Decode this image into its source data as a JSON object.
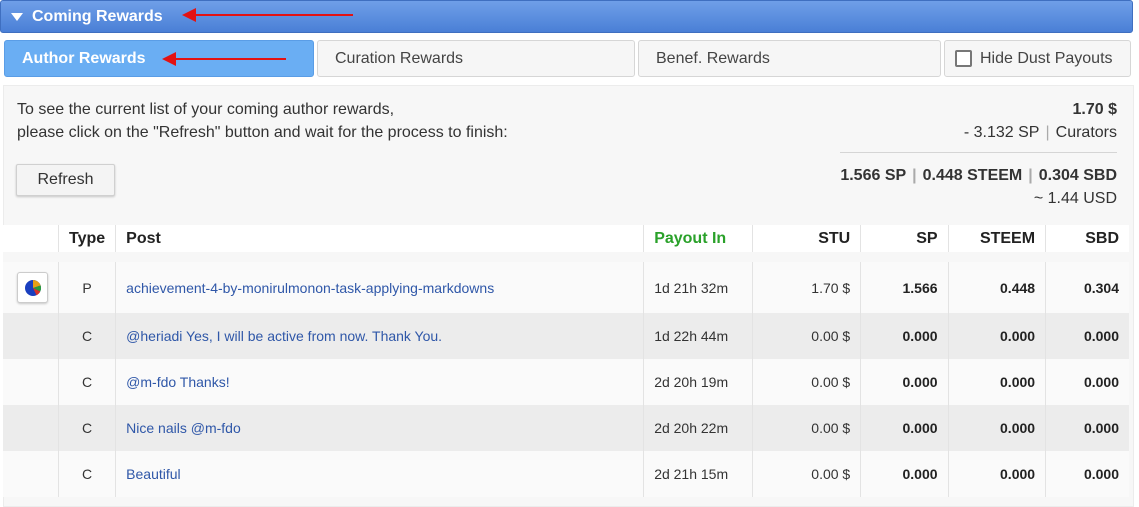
{
  "header": {
    "title": "Coming Rewards"
  },
  "tabs": [
    {
      "label": "Author Rewards",
      "active": true
    },
    {
      "label": "Curation Rewards",
      "active": false
    },
    {
      "label": "Benef. Rewards",
      "active": false
    }
  ],
  "hide_dust": {
    "label": "Hide Dust Payouts",
    "checked": false
  },
  "info": {
    "line1": "To see the current list of your coming author rewards,",
    "line2": "please click on the \"Refresh\" button and wait for the process to finish:"
  },
  "refresh_label": "Refresh",
  "summary": {
    "total_usd": "1.70 $",
    "curators_sp": "- 3.132 SP",
    "curators_label": "Curators",
    "sp": "1.566 SP",
    "steem": "0.448 STEEM",
    "sbd": "0.304 SBD",
    "approx_usd": "~ 1.44 USD"
  },
  "table": {
    "headers": [
      "",
      "Type",
      "Post",
      "Payout In",
      "STU",
      "SP",
      "STEEM",
      "SBD"
    ],
    "rows": [
      {
        "type": "P",
        "post": "achievement-4-by-monirulmonon-task-applying-markdowns",
        "payout": "1d 21h 32m",
        "stu": "1.70 $",
        "sp": "1.566",
        "steem": "0.448",
        "sbd": "0.304",
        "icon": "pie-chart-icon"
      },
      {
        "type": "C",
        "post": "@heriadi Yes, I will be active from now. Thank You.",
        "payout": "1d 22h 44m",
        "stu": "0.00 $",
        "sp": "0.000",
        "steem": "0.000",
        "sbd": "0.000"
      },
      {
        "type": "C",
        "post": "@m-fdo Thanks!",
        "payout": "2d 20h 19m",
        "stu": "0.00 $",
        "sp": "0.000",
        "steem": "0.000",
        "sbd": "0.000"
      },
      {
        "type": "C",
        "post": "Nice nails @m-fdo",
        "payout": "2d 20h 22m",
        "stu": "0.00 $",
        "sp": "0.000",
        "steem": "0.000",
        "sbd": "0.000"
      },
      {
        "type": "C",
        "post": "Beautiful",
        "payout": "2d 21h 15m",
        "stu": "0.00 $",
        "sp": "0.000",
        "steem": "0.000",
        "sbd": "0.000"
      }
    ]
  },
  "colors": {
    "header": "#4a7fd6",
    "active_tab": "#6aaef3",
    "payout_header": "#2aa12a",
    "link": "#2f57a8",
    "arrow": "#e31212"
  }
}
